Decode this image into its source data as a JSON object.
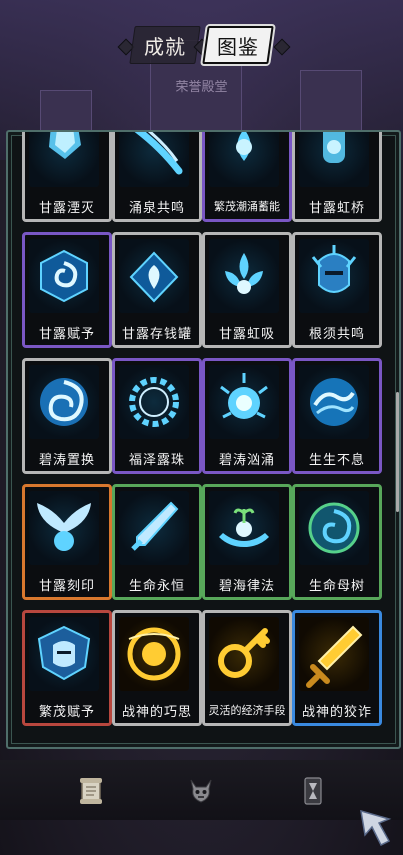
{
  "tabs": [
    {
      "label": "成就",
      "active": false
    },
    {
      "label": "图鉴",
      "active": true
    }
  ],
  "subtitle": "荣誉殿堂",
  "cards": [
    {
      "label": "甘露湮灭",
      "frame": "gray",
      "icon": "crystal-icon"
    },
    {
      "label": "涌泉共鸣",
      "frame": "gray",
      "icon": "water-slash-icon"
    },
    {
      "label": "繁茂潮涌蓄能",
      "frame": "purple",
      "icon": "lotus-wave-icon"
    },
    {
      "label": "甘露虹桥",
      "frame": "gray",
      "icon": "water-flask-icon"
    },
    {
      "label": "甘露赋予",
      "frame": "purple",
      "icon": "water-vortex-icon"
    },
    {
      "label": "甘露存钱罐",
      "frame": "gray",
      "icon": "water-heart-icon"
    },
    {
      "label": "甘露虹吸",
      "frame": "gray",
      "icon": "water-flower-icon"
    },
    {
      "label": "根须共鸣",
      "frame": "gray",
      "icon": "water-helmet-icon"
    },
    {
      "label": "碧涛置换",
      "frame": "gray",
      "icon": "swirl-icon"
    },
    {
      "label": "福泽露珠",
      "frame": "purple",
      "icon": "laurel-wreath-icon"
    },
    {
      "label": "碧涛汹涌",
      "frame": "purple",
      "icon": "splash-orb-icon"
    },
    {
      "label": "生生不息",
      "frame": "purple",
      "icon": "wave-orb-icon"
    },
    {
      "label": "甘露刻印",
      "frame": "orange",
      "icon": "winged-vortex-icon"
    },
    {
      "label": "生命永恒",
      "frame": "green",
      "icon": "water-sword-icon"
    },
    {
      "label": "碧海律法",
      "frame": "green",
      "icon": "sprout-hands-icon"
    },
    {
      "label": "生命母树",
      "frame": "green",
      "icon": "green-vortex-icon"
    },
    {
      "label": "繁茂赋予",
      "frame": "red",
      "icon": "crowned-helmet-icon"
    },
    {
      "label": "战神的巧思",
      "frame": "gray",
      "icon": "golden-orb-icon"
    },
    {
      "label": "灵活的经济手段",
      "frame": "gray",
      "icon": "golden-key-icon"
    },
    {
      "label": "战神的狡诈",
      "frame": "blue",
      "icon": "golden-sword-icon"
    }
  ],
  "nav": [
    {
      "icon": "scroll-icon"
    },
    {
      "icon": "demon-skull-icon"
    },
    {
      "icon": "hourglass-card-icon"
    }
  ],
  "colors": {
    "water_glow": "#5fd3ff",
    "gold_glow": "#ffcc33",
    "panel_border": "#4f6e6a"
  }
}
